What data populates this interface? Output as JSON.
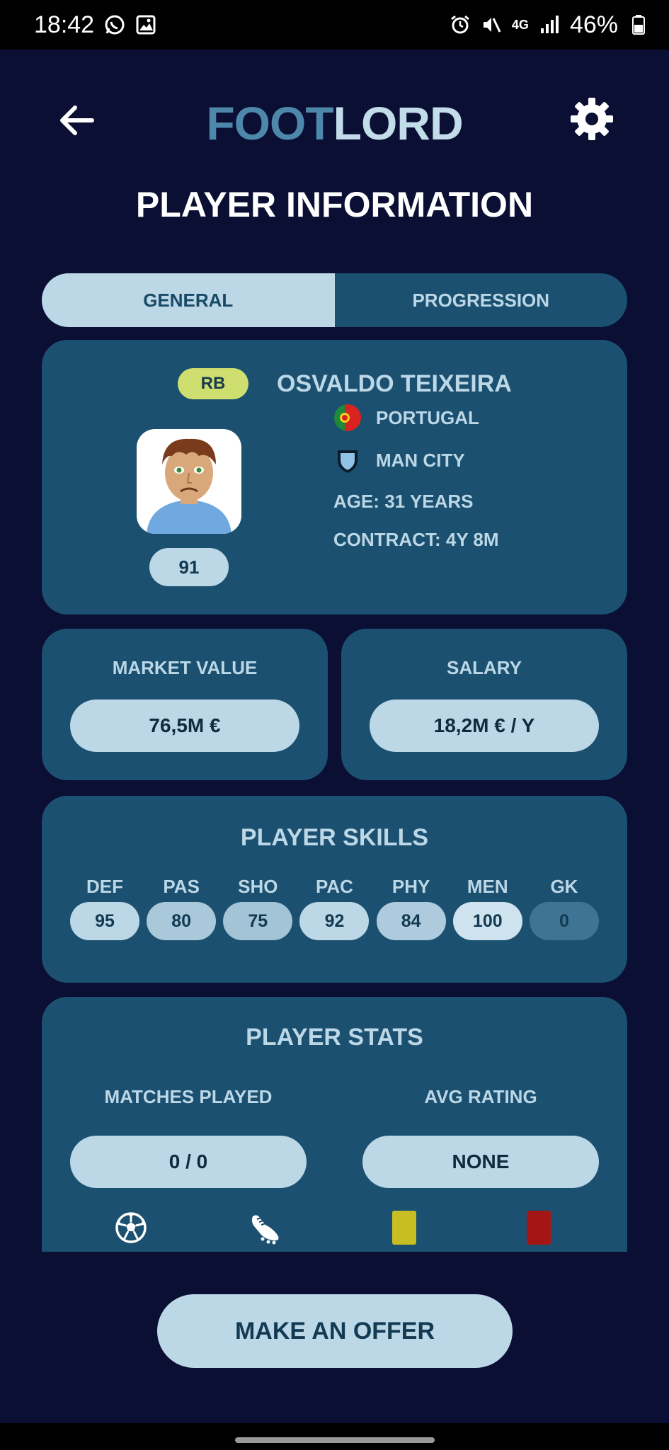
{
  "status_bar": {
    "time": "18:42",
    "battery": "46%",
    "network": "4G",
    "icons": [
      "whatsapp-icon",
      "image-icon",
      "alarm-icon",
      "mute-icon",
      "signal-icon",
      "battery-icon"
    ]
  },
  "header": {
    "logo_part1": "FOOT",
    "logo_part2": "LORD",
    "back_icon": "arrow-left-icon",
    "settings_icon": "gear-icon"
  },
  "page_title": "PLAYER INFORMATION",
  "tabs": [
    {
      "label": "GENERAL",
      "active": true
    },
    {
      "label": "PROGRESSION",
      "active": false
    }
  ],
  "player": {
    "position": "RB",
    "name": "OSVALDO TEIXEIRA",
    "rating": "91",
    "country": "PORTUGAL",
    "club": "MAN CITY",
    "age": "AGE: 31 YEARS",
    "contract": "CONTRACT: 4Y 8M"
  },
  "market_value": {
    "label": "MARKET VALUE",
    "value": "76,5M €"
  },
  "salary": {
    "label": "SALARY",
    "value": "18,2M € / Y"
  },
  "skills": {
    "title": "PLAYER SKILLS",
    "items": [
      {
        "label": "DEF",
        "value": "95",
        "color": "#bcd7e6"
      },
      {
        "label": "PAS",
        "value": "80",
        "color": "#a9c9da"
      },
      {
        "label": "SHO",
        "value": "75",
        "color": "#a3c3d6"
      },
      {
        "label": "PAC",
        "value": "92",
        "color": "#bcd7e6"
      },
      {
        "label": "PHY",
        "value": "84",
        "color": "#adcbdc"
      },
      {
        "label": "MEN",
        "value": "100",
        "color": "#cfe3ee"
      },
      {
        "label": "GK",
        "value": "0",
        "color": "#3f7495"
      }
    ]
  },
  "stats": {
    "title": "PLAYER STATS",
    "matches_label": "MATCHES PLAYED",
    "matches_value": "0 / 0",
    "rating_label": "AVG RATING",
    "rating_value": "NONE",
    "icons": [
      "soccer-ball-icon",
      "boot-icon",
      "yellow-card-icon",
      "red-card-icon"
    ]
  },
  "offer_button": "MAKE AN OFFER",
  "colors": {
    "background": "#0a0f33",
    "card": "#1b5070",
    "pill": "#bcd7e6",
    "badge": "#cedf70",
    "yellow_card": "#c8bd22",
    "red_card": "#a41515"
  }
}
